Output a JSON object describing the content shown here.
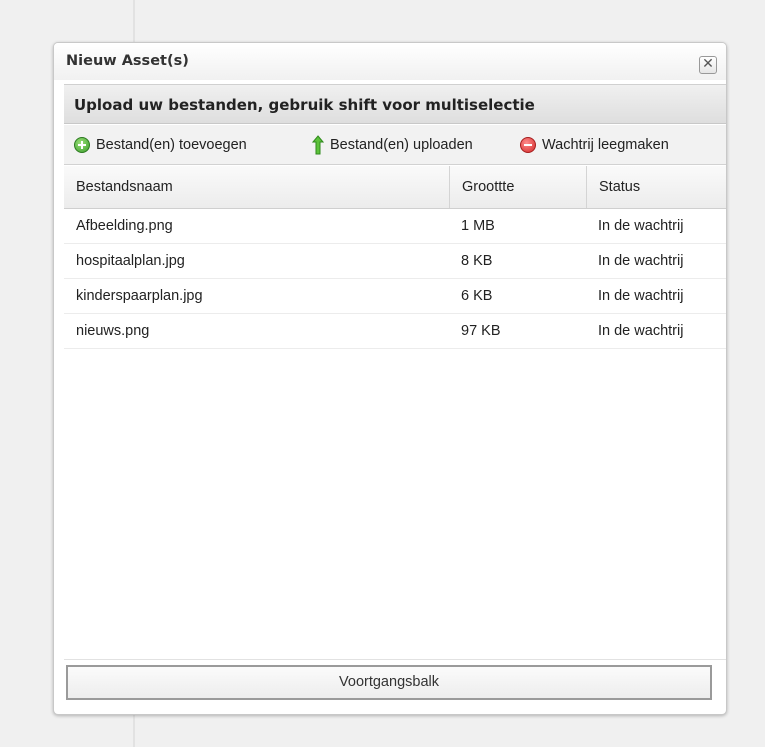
{
  "window": {
    "title": "Nieuw Asset(s)",
    "close_symbol": "✕"
  },
  "panel": {
    "header": "Upload uw bestanden, gebruik shift voor multiselectie"
  },
  "toolbar": {
    "add_label": "Bestand(en) toevoegen",
    "upload_label": "Bestand(en) uploaden",
    "clear_label": "Wachtrij leegmaken",
    "icons": {
      "add": "add-circle-icon",
      "upload": "arrow-up-icon",
      "clear": "remove-circle-icon"
    },
    "colors": {
      "add": "#3a9d2a",
      "upload": "#4caf2e",
      "clear": "#d42a2a"
    }
  },
  "grid": {
    "columns": [
      "Bestandsnaam",
      "Groottte",
      "Status"
    ],
    "rows": [
      {
        "name": "Afbeelding.png",
        "size": "1 MB",
        "status": "In de wachtrij"
      },
      {
        "name": "hospitaalplan.jpg",
        "size": "8 KB",
        "status": "In de wachtrij"
      },
      {
        "name": "kinderspaarplan.jpg",
        "size": "6 KB",
        "status": "In de wachtrij"
      },
      {
        "name": "nieuws.png",
        "size": "97 KB",
        "status": "In de wachtrij"
      }
    ]
  },
  "progress": {
    "label": "Voortgangsbalk"
  }
}
